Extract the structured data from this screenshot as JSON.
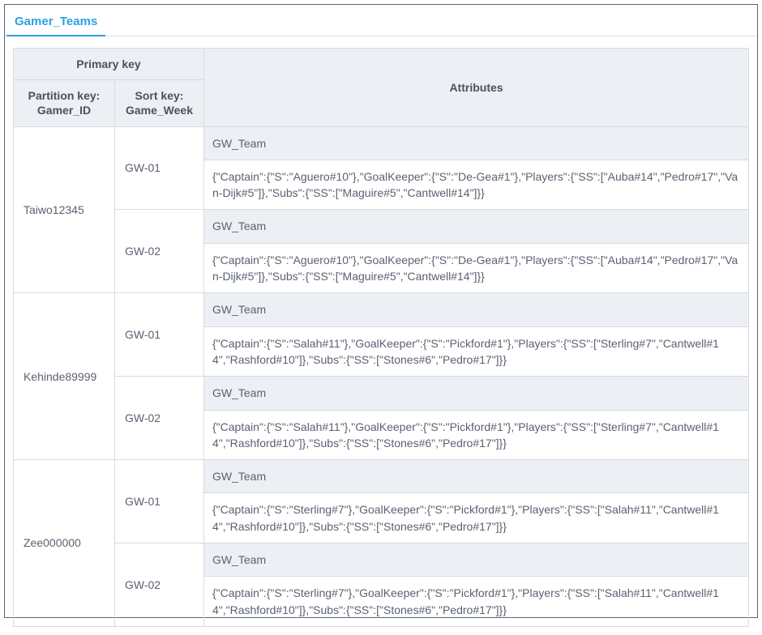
{
  "tab": {
    "title": "Gamer_Teams"
  },
  "headers": {
    "primary_key": "Primary key",
    "partition": "Partition key: Gamer_ID",
    "sort": "Sort key: Game_Week",
    "attributes": "Attributes"
  },
  "rows": [
    {
      "gamer_id": "Taiwo12345",
      "weeks": [
        {
          "week": "GW-01",
          "attr_label": "GW_Team",
          "attr_value": "{\"Captain\":{\"S\":\"Aguero#10\"},\"GoalKeeper\":{\"S\":\"De-Gea#1\"},\"Players\":{\"SS\":[\"Auba#14\",\"Pedro#17\",\"Van-Dijk#5\"]},\"Subs\":{\"SS\":[\"Maguire#5\",\"Cantwell#14\"]}}"
        },
        {
          "week": "GW-02",
          "attr_label": "GW_Team",
          "attr_value": "{\"Captain\":{\"S\":\"Aguero#10\"},\"GoalKeeper\":{\"S\":\"De-Gea#1\"},\"Players\":{\"SS\":[\"Auba#14\",\"Pedro#17\",\"Van-Dijk#5\"]},\"Subs\":{\"SS\":[\"Maguire#5\",\"Cantwell#14\"]}}"
        }
      ]
    },
    {
      "gamer_id": "Kehinde89999",
      "weeks": [
        {
          "week": "GW-01",
          "attr_label": "GW_Team",
          "attr_value": "{\"Captain\":{\"S\":\"Salah#11\"},\"GoalKeeper\":{\"S\":\"Pickford#1\"},\"Players\":{\"SS\":[\"Sterling#7\",\"Cantwell#14\",\"Rashford#10\"]},\"Subs\":{\"SS\":[\"Stones#6\",\"Pedro#17\"]}}"
        },
        {
          "week": "GW-02",
          "attr_label": "GW_Team",
          "attr_value": "{\"Captain\":{\"S\":\"Salah#11\"},\"GoalKeeper\":{\"S\":\"Pickford#1\"},\"Players\":{\"SS\":[\"Sterling#7\",\"Cantwell#14\",\"Rashford#10\"]},\"Subs\":{\"SS\":[\"Stones#6\",\"Pedro#17\"]}}"
        }
      ]
    },
    {
      "gamer_id": "Zee000000",
      "weeks": [
        {
          "week": "GW-01",
          "attr_label": "GW_Team",
          "attr_value": "{\"Captain\":{\"S\":\"Sterling#7\"},\"GoalKeeper\":{\"S\":\"Pickford#1\"},\"Players\":{\"SS\":[\"Salah#11\",\"Cantwell#14\",\"Rashford#10\"]},\"Subs\":{\"SS\":[\"Stones#6\",\"Pedro#17\"]}}"
        },
        {
          "week": "GW-02",
          "attr_label": "GW_Team",
          "attr_value": "{\"Captain\":{\"S\":\"Sterling#7\"},\"GoalKeeper\":{\"S\":\"Pickford#1\"},\"Players\":{\"SS\":[\"Salah#11\",\"Cantwell#14\",\"Rashford#10\"]},\"Subs\":{\"SS\":[\"Stones#6\",\"Pedro#17\"]}}"
        }
      ]
    }
  ]
}
